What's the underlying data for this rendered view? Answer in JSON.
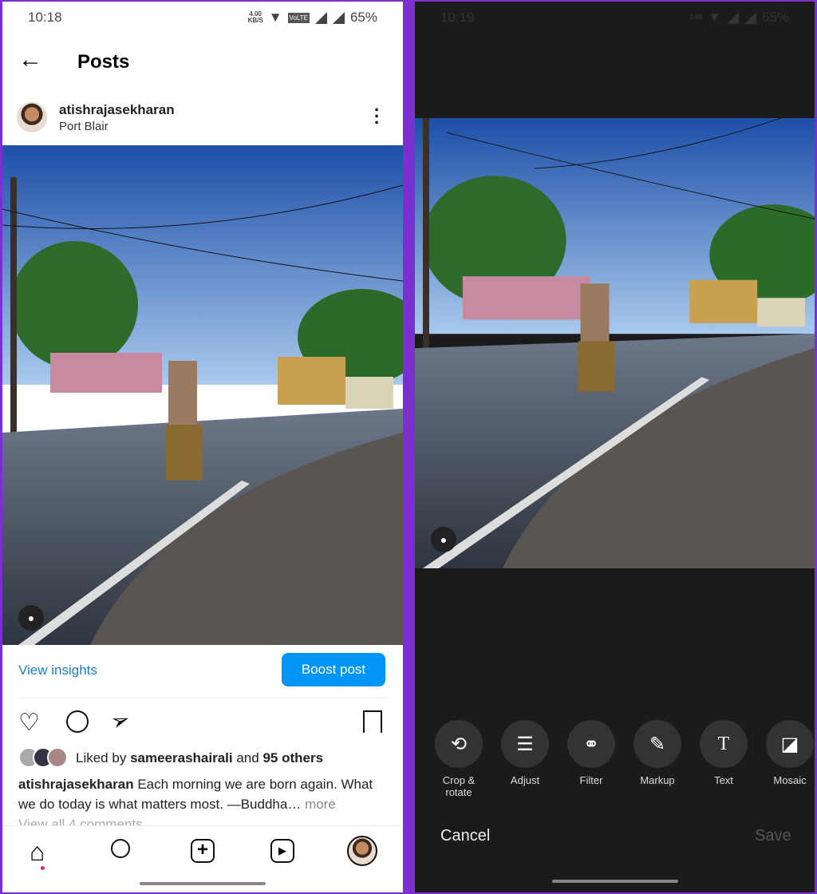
{
  "left": {
    "status": {
      "time": "10:18",
      "net_speed": "4.00",
      "net_unit": "KB/S",
      "volte": "VoLTE",
      "battery": "65%"
    },
    "header": {
      "title": "Posts"
    },
    "post": {
      "username": "atishrajasekharan",
      "location": "Port Blair",
      "view_insights": "View insights",
      "boost": "Boost post",
      "liked_prefix": "Liked by",
      "liked_user": "sameerashairali",
      "liked_and": "and",
      "liked_count": "95 others",
      "caption_user": "atishrajasekharan",
      "caption": "Each morning we are born again. What we do today is what matters most. —Buddha…",
      "more": "more",
      "comments": "View all 4 comments"
    },
    "nav": [
      "home-icon",
      "search-icon",
      "create-icon",
      "reels-icon",
      "profile-avatar"
    ],
    "accent": "#0095f6"
  },
  "right": {
    "status": {
      "time": "10:19",
      "net_speed": "2.00",
      "battery": "65%"
    },
    "tools": [
      {
        "label": "Crop & rotate",
        "icon": "crop-rotate-icon"
      },
      {
        "label": "Adjust",
        "icon": "sliders-icon"
      },
      {
        "label": "Filter",
        "icon": "filter-icon"
      },
      {
        "label": "Markup",
        "icon": "pen-icon"
      },
      {
        "label": "Text",
        "icon": "text-icon"
      },
      {
        "label": "Mosaic",
        "icon": "mosaic-icon"
      }
    ],
    "cancel": "Cancel",
    "save": "Save"
  }
}
